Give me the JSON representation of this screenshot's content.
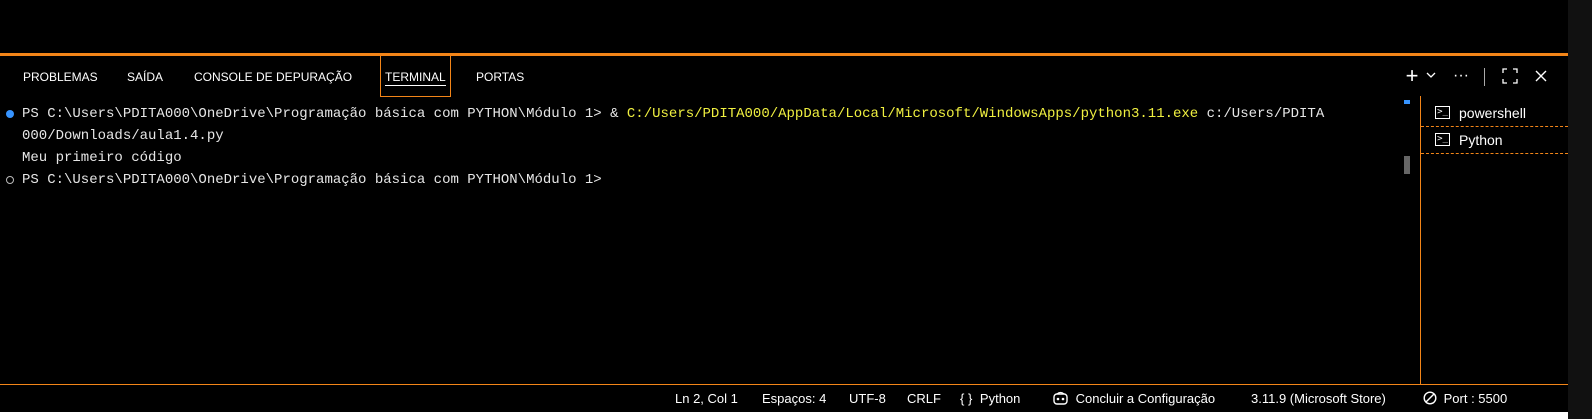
{
  "tabs": [
    {
      "label": "PROBLEMAS"
    },
    {
      "label": "SAÍDA"
    },
    {
      "label": "CONSOLE DE DEPURAÇÃO"
    },
    {
      "label": "TERMINAL"
    },
    {
      "label": "PORTAS"
    }
  ],
  "active_tab": "TERMINAL",
  "toolbar": {
    "new_terminal_icon": "plus-icon",
    "dropdown_icon": "chevron-down-icon",
    "more_icon": "ellipsis-icon",
    "maximize_icon": "maximize-icon",
    "close_icon": "close-icon"
  },
  "terminal": {
    "line1_prompt": "PS C:\\Users\\PDITA000\\OneDrive\\Programação básica com PYTHON\\Módulo 1> & ",
    "line1_exe": "C:/Users/PDITA000/AppData/Local/Microsoft/WindowsApps/python3.11.exe",
    "line1_arg": " c:/Users/PDITA",
    "line2": "000/Downloads/aula1.4.py",
    "line3": "Meu primeiro código",
    "line4": "PS C:\\Users\\PDITA000\\OneDrive\\Programação básica com PYTHON\\Módulo 1>"
  },
  "terminal_list": [
    {
      "label": "powershell"
    },
    {
      "label": "Python"
    }
  ],
  "status": {
    "position": "Ln 2, Col 1",
    "spaces": "Espaços: 4",
    "encoding": "UTF-8",
    "eol": "CRLF",
    "language_icon": "{ }",
    "language": "Python",
    "setup": "Concluir a Configuração",
    "interpreter": "3.11.9 (Microsoft Store)",
    "port": "Port : 5500"
  },
  "colors": {
    "accent": "#f38518",
    "terminal_path": "#f0f040",
    "success_dot": "#3794ff"
  }
}
